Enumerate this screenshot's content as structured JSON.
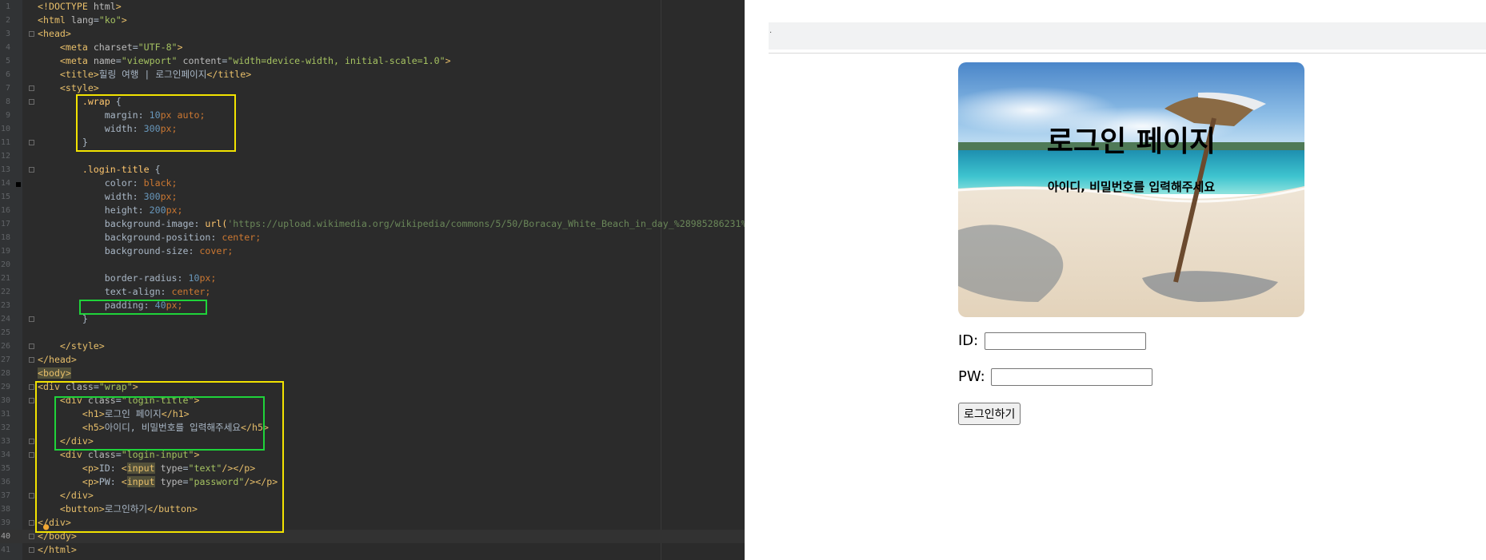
{
  "editor": {
    "lines": [
      {
        "n": "1",
        "segs": [
          {
            "c": "t",
            "t": "<!DOCTYPE "
          },
          {
            "c": "a",
            "t": "html"
          },
          {
            "c": "t",
            "t": ">"
          }
        ]
      },
      {
        "n": "2",
        "segs": [
          {
            "c": "t",
            "t": "<html "
          },
          {
            "c": "a",
            "t": "lang"
          },
          {
            "c": "tb",
            "t": "="
          },
          {
            "c": "v",
            "t": "\"ko\""
          },
          {
            "c": "t",
            "t": ">"
          }
        ]
      },
      {
        "n": "3",
        "segs": [
          {
            "c": "t",
            "t": "<head>"
          }
        ]
      },
      {
        "n": "4",
        "segs": [
          {
            "c": "tb",
            "t": "    "
          },
          {
            "c": "t",
            "t": "<meta "
          },
          {
            "c": "a",
            "t": "charset"
          },
          {
            "c": "tb",
            "t": "="
          },
          {
            "c": "v",
            "t": "\"UTF-8\""
          },
          {
            "c": "t",
            "t": ">"
          }
        ]
      },
      {
        "n": "5",
        "segs": [
          {
            "c": "tb",
            "t": "    "
          },
          {
            "c": "t",
            "t": "<meta "
          },
          {
            "c": "a",
            "t": "name"
          },
          {
            "c": "tb",
            "t": "="
          },
          {
            "c": "v",
            "t": "\"viewport\" "
          },
          {
            "c": "a",
            "t": "content"
          },
          {
            "c": "tb",
            "t": "="
          },
          {
            "c": "v",
            "t": "\"width=device-width, initial-scale=1.0\""
          },
          {
            "c": "t",
            "t": ">"
          }
        ]
      },
      {
        "n": "6",
        "segs": [
          {
            "c": "tb",
            "t": "    "
          },
          {
            "c": "t",
            "t": "<title>"
          },
          {
            "c": "tb",
            "t": "힐링 여행 | 로그인페이지"
          },
          {
            "c": "t",
            "t": "</title>"
          }
        ]
      },
      {
        "n": "7",
        "segs": [
          {
            "c": "tb",
            "t": "    "
          },
          {
            "c": "t",
            "t": "<style>"
          }
        ]
      },
      {
        "n": "8",
        "segs": [
          {
            "c": "tb",
            "t": "        "
          },
          {
            "c": "s",
            "t": ".wrap"
          },
          {
            "c": "tb",
            "t": " {"
          }
        ]
      },
      {
        "n": "9",
        "segs": [
          {
            "c": "tb",
            "t": "            margin: "
          },
          {
            "c": "n",
            "t": "10"
          },
          {
            "c": "kw",
            "t": "px auto;"
          }
        ]
      },
      {
        "n": "10",
        "segs": [
          {
            "c": "tb",
            "t": "            width: "
          },
          {
            "c": "n",
            "t": "300"
          },
          {
            "c": "kw",
            "t": "px;"
          }
        ]
      },
      {
        "n": "11",
        "segs": [
          {
            "c": "tb",
            "t": "        }"
          }
        ]
      },
      {
        "n": "12",
        "segs": []
      },
      {
        "n": "13",
        "segs": [
          {
            "c": "tb",
            "t": "        "
          },
          {
            "c": "s",
            "t": ".login-title"
          },
          {
            "c": "tb",
            "t": " {"
          }
        ]
      },
      {
        "n": "14",
        "segs": [
          {
            "c": "tb",
            "t": "            color: "
          },
          {
            "c": "kw",
            "t": "black;"
          }
        ]
      },
      {
        "n": "15",
        "segs": [
          {
            "c": "tb",
            "t": "            width: "
          },
          {
            "c": "n",
            "t": "300"
          },
          {
            "c": "kw",
            "t": "px;"
          }
        ]
      },
      {
        "n": "16",
        "segs": [
          {
            "c": "tb",
            "t": "            height: "
          },
          {
            "c": "n",
            "t": "200"
          },
          {
            "c": "kw",
            "t": "px;"
          }
        ]
      },
      {
        "n": "17",
        "segs": [
          {
            "c": "tb",
            "t": "            background-image: "
          },
          {
            "c": "s",
            "t": "url("
          },
          {
            "c": "u",
            "t": "'https://upload.wikimedia.org/wikipedia/commons/5/50/Boracay_White_Beach_in_day_%28985286231%29.jpg'"
          },
          {
            "c": "s",
            "t": ")"
          },
          {
            "c": "kw",
            "t": ";"
          }
        ]
      },
      {
        "n": "18",
        "segs": [
          {
            "c": "tb",
            "t": "            background-position: "
          },
          {
            "c": "kw",
            "t": "center;"
          }
        ]
      },
      {
        "n": "19",
        "segs": [
          {
            "c": "tb",
            "t": "            background-size: "
          },
          {
            "c": "kw",
            "t": "cover;"
          }
        ]
      },
      {
        "n": "20",
        "segs": []
      },
      {
        "n": "21",
        "segs": [
          {
            "c": "tb",
            "t": "            border-radius: "
          },
          {
            "c": "n",
            "t": "10"
          },
          {
            "c": "kw",
            "t": "px;"
          }
        ]
      },
      {
        "n": "22",
        "segs": [
          {
            "c": "tb",
            "t": "            text-align: "
          },
          {
            "c": "kw",
            "t": "center;"
          }
        ]
      },
      {
        "n": "23",
        "segs": [
          {
            "c": "tb",
            "t": "            padding: "
          },
          {
            "c": "n",
            "t": "40"
          },
          {
            "c": "kw",
            "t": "px;"
          }
        ]
      },
      {
        "n": "24",
        "segs": [
          {
            "c": "tb",
            "t": "        }"
          }
        ]
      },
      {
        "n": "25",
        "segs": []
      },
      {
        "n": "26",
        "segs": [
          {
            "c": "tb",
            "t": "    "
          },
          {
            "c": "t",
            "t": "</style>"
          }
        ]
      },
      {
        "n": "27",
        "segs": [
          {
            "c": "t",
            "t": "</head>"
          }
        ]
      },
      {
        "n": "28",
        "segs": [
          {
            "c": "t hl",
            "t": "<body>"
          }
        ]
      },
      {
        "n": "29",
        "segs": [
          {
            "c": "t",
            "t": "<div "
          },
          {
            "c": "a",
            "t": "class"
          },
          {
            "c": "tb",
            "t": "="
          },
          {
            "c": "v",
            "t": "\"wrap\""
          },
          {
            "c": "t",
            "t": ">"
          }
        ]
      },
      {
        "n": "30",
        "segs": [
          {
            "c": "tb",
            "t": "    "
          },
          {
            "c": "t",
            "t": "<div "
          },
          {
            "c": "a",
            "t": "class"
          },
          {
            "c": "tb",
            "t": "="
          },
          {
            "c": "v",
            "t": "\"login-title\""
          },
          {
            "c": "t",
            "t": ">"
          }
        ]
      },
      {
        "n": "31",
        "segs": [
          {
            "c": "tb",
            "t": "        "
          },
          {
            "c": "t",
            "t": "<h1>"
          },
          {
            "c": "tb",
            "t": "로그인 페이지"
          },
          {
            "c": "t",
            "t": "</h1>"
          }
        ]
      },
      {
        "n": "32",
        "segs": [
          {
            "c": "tb",
            "t": "        "
          },
          {
            "c": "t",
            "t": "<h5>"
          },
          {
            "c": "tb",
            "t": "아이디, 비밀번호를 입력해주세요"
          },
          {
            "c": "t",
            "t": "</h5>"
          }
        ]
      },
      {
        "n": "33",
        "segs": [
          {
            "c": "tb",
            "t": "    "
          },
          {
            "c": "t",
            "t": "</div>"
          }
        ]
      },
      {
        "n": "34",
        "segs": [
          {
            "c": "tb",
            "t": "    "
          },
          {
            "c": "t",
            "t": "<div "
          },
          {
            "c": "a",
            "t": "class"
          },
          {
            "c": "tb",
            "t": "="
          },
          {
            "c": "v",
            "t": "\"login-input\""
          },
          {
            "c": "t",
            "t": ">"
          }
        ]
      },
      {
        "n": "35",
        "segs": [
          {
            "c": "tb",
            "t": "        "
          },
          {
            "c": "t",
            "t": "<p>"
          },
          {
            "c": "tb",
            "t": "ID: "
          },
          {
            "c": "t",
            "t": "<"
          },
          {
            "c": "t hl",
            "t": "input"
          },
          {
            "c": "a",
            "t": " type"
          },
          {
            "c": "tb",
            "t": "="
          },
          {
            "c": "v",
            "t": "\"text\""
          },
          {
            "c": "t",
            "t": "/></p>"
          }
        ]
      },
      {
        "n": "36",
        "segs": [
          {
            "c": "tb",
            "t": "        "
          },
          {
            "c": "t",
            "t": "<p>"
          },
          {
            "c": "tb",
            "t": "PW: "
          },
          {
            "c": "t",
            "t": "<"
          },
          {
            "c": "t hl",
            "t": "input"
          },
          {
            "c": "a",
            "t": " type"
          },
          {
            "c": "tb",
            "t": "="
          },
          {
            "c": "v",
            "t": "\"password\""
          },
          {
            "c": "t",
            "t": "/></p>"
          }
        ]
      },
      {
        "n": "37",
        "segs": [
          {
            "c": "tb",
            "t": "    "
          },
          {
            "c": "t",
            "t": "</div>"
          }
        ]
      },
      {
        "n": "38",
        "segs": [
          {
            "c": "tb",
            "t": "    "
          },
          {
            "c": "t",
            "t": "<button>"
          },
          {
            "c": "tb",
            "t": "로그인하기"
          },
          {
            "c": "t",
            "t": "</button>"
          }
        ]
      },
      {
        "n": "39",
        "segs": [
          {
            "c": "t",
            "t": "</div>"
          }
        ]
      },
      {
        "n": "40",
        "segs": [
          {
            "c": "t",
            "t": "</body>"
          }
        ],
        "current": true
      },
      {
        "n": "41",
        "segs": [
          {
            "c": "t",
            "t": "</html>"
          }
        ]
      }
    ],
    "highlight_colors": {
      "yellow": "#f2e300",
      "green": "#1fd33a"
    }
  },
  "preview": {
    "login_title": {
      "h1": "로그인 페이지",
      "h5": "아이디, 비밀번호를 입력해주세요"
    },
    "id_label": "ID:",
    "pw_label": "PW:",
    "id_value": "",
    "pw_value": "",
    "button_label": "로그인하기",
    "toolbar_glyph": "·"
  }
}
